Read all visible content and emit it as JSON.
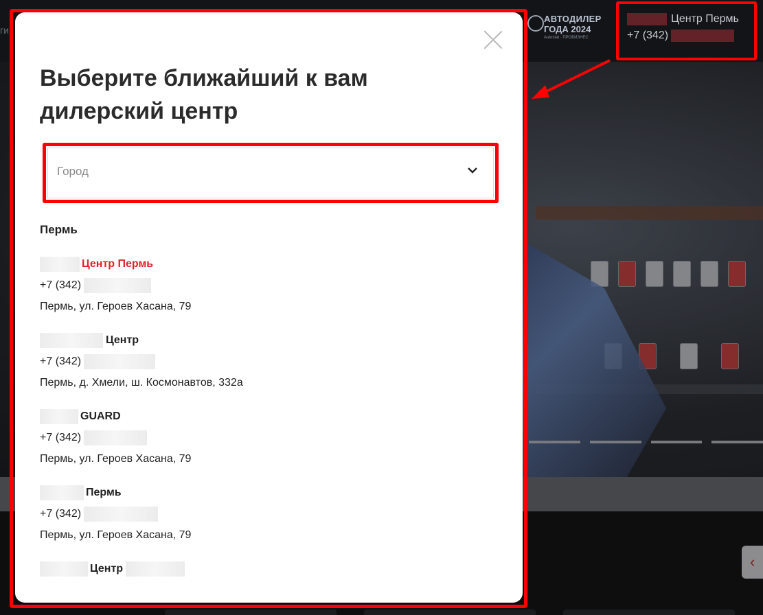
{
  "header": {
    "award_logo": {
      "line1": "АВТОДИЛЕР",
      "line2": "ГОДА 2024",
      "line3": "Autostat · ПРОБИЗНЕС"
    },
    "dealer_name": "Центр Пермь",
    "dealer_phone": "+7 (342) "
  },
  "modal": {
    "title": "Выберите ближайший к вам дилерский центр",
    "select_placeholder": "Город",
    "city": "Пермь",
    "dealers": [
      {
        "name": "Центр Пермь",
        "phone": "+7 (342) ",
        "address": "Пермь, ул. Героев Хасана, 79",
        "active": true
      },
      {
        "name": "Центр",
        "phone": "+7 (342) ",
        "address": "Пермь, д. Хмели, ш. Космонавтов, 332а"
      },
      {
        "name": "GUARD",
        "phone": "+7 (342) ",
        "address": "Пермь, ул. Героев Хасана, 79"
      },
      {
        "name": "Пермь",
        "phone": "+7 (342) ",
        "address": "Пермь, ул. Героев Хасана, 79"
      },
      {
        "name": "Центр"
      }
    ]
  },
  "colors": {
    "accent": "#e2202b",
    "highlight": "#ff0000"
  },
  "icons": [
    "close-icon",
    "chevron-down-icon",
    "arrow-icon",
    "chevron-left-icon"
  ]
}
